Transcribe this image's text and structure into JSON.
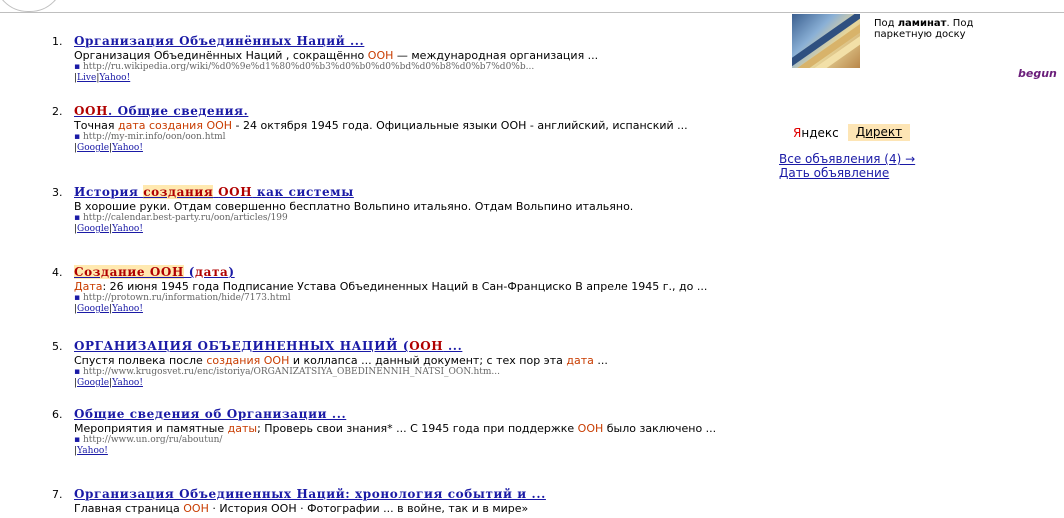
{
  "results": [
    {
      "num": "1.",
      "title": [
        {
          "t": "Организация Объединённых Наций ..."
        }
      ],
      "snippet": [
        {
          "t": "Организация Объединённых Наций , сокращённо "
        },
        {
          "t": "ООН",
          "hl": true
        },
        {
          "t": " — международная организация ..."
        }
      ],
      "url": "http://ru.wikipedia.org/wiki/%d0%9e%d1%80%d0%b3%d0%b0%d0%bd%d0%b8%d0%b7%d0%b...",
      "links": [
        "Live",
        "Yahoo!"
      ]
    },
    {
      "num": "2.",
      "title": [
        {
          "t": "ООН",
          "hl": true
        },
        {
          "t": ". Общие сведения."
        }
      ],
      "snippet": [
        {
          "t": "Точная "
        },
        {
          "t": "дата",
          "hl": true
        },
        {
          "t": " "
        },
        {
          "t": "создания",
          "hl": true
        },
        {
          "t": " "
        },
        {
          "t": "ООН",
          "hl": true
        },
        {
          "t": " - 24 октября 1945 года. Официальные языки ООН - английский, испанский ..."
        }
      ],
      "url": "http://my-mir.info/oon/oon.html",
      "links": [
        "Google",
        "Yahoo!"
      ]
    },
    {
      "num": "3.",
      "title": [
        {
          "t": "История "
        },
        {
          "t": "создания",
          "hl": "bg"
        },
        {
          "t": " "
        },
        {
          "t": "ООН",
          "hl": true
        },
        {
          "t": " как системы"
        }
      ],
      "snippet": [
        {
          "t": "В хорошие руки. Отдам совершенно бесплатно Вольпино итальяно. Отдам Вольпино итальяно."
        }
      ],
      "url": "http://calendar.best-party.ru/oon/articles/199",
      "links": [
        "Google",
        "Yahoo!"
      ]
    },
    {
      "num": "4.",
      "title": [
        {
          "t": "Создание ООН",
          "hl": "bg"
        },
        {
          "t": " ("
        },
        {
          "t": "дата",
          "hl": true
        },
        {
          "t": ")"
        }
      ],
      "snippet": [
        {
          "t": "Дата",
          "hl": true
        },
        {
          "t": ": 26 июня 1945 года Подписание Устава Объединенных Наций в Сан-Франциско В апреле 1945 г., до ..."
        }
      ],
      "url": "http://protown.ru/information/hide/7173.html",
      "links": [
        "Google",
        "Yahoo!"
      ]
    },
    {
      "num": "5.",
      "title": [
        {
          "t": "ОРГАНИЗАЦИЯ ОБЪЕДИНЕННЫХ НАЦИЙ ("
        },
        {
          "t": "ООН",
          "hl": true
        },
        {
          "t": " ..."
        }
      ],
      "snippet": [
        {
          "t": "Спустя полвека после "
        },
        {
          "t": "создания",
          "hl": true
        },
        {
          "t": " "
        },
        {
          "t": "ООН",
          "hl": true
        },
        {
          "t": " и коллапса ... данный документ; с тех пор эта "
        },
        {
          "t": "дата",
          "hl": true
        },
        {
          "t": " ..."
        }
      ],
      "url": "http://www.krugosvet.ru/enc/istoriya/ORGANIZATSIYA_OBEDINENNIH_NATSI_OON.htm...",
      "links": [
        "Google",
        "Yahoo!"
      ]
    },
    {
      "num": "6.",
      "title": [
        {
          "t": "Общие сведения об Организации ..."
        }
      ],
      "snippet": [
        {
          "t": "Мероприятия и памятные "
        },
        {
          "t": "даты",
          "hl": true
        },
        {
          "t": "; Проверь свои знания* ... С 1945 года при поддержке "
        },
        {
          "t": "ООН",
          "hl": true
        },
        {
          "t": " было заключено ..."
        }
      ],
      "url": "http://www.un.org/ru/aboutun/",
      "links": [
        "Yahoo!"
      ]
    },
    {
      "num": "7.",
      "title": [
        {
          "t": "Организация Объединенных Наций: хронология событий и ..."
        }
      ],
      "snippet": [
        {
          "t": "Главная страница "
        },
        {
          "t": "ООН",
          "hl": true
        },
        {
          "t": " · История ООН · Фотографии ... в войне, так и в мире»"
        }
      ],
      "url": "",
      "links": []
    }
  ],
  "ad": {
    "text_bold": "ламинат",
    "text_before": "Под ",
    "text_after": ". Под паркетную доску"
  },
  "begun": "begun",
  "yandex": {
    "y": "Я",
    "rest": "ндекс",
    "direkt": "Директ"
  },
  "ad_links": {
    "all": "Все объявления (4) →",
    "give": "Дать объявление"
  }
}
